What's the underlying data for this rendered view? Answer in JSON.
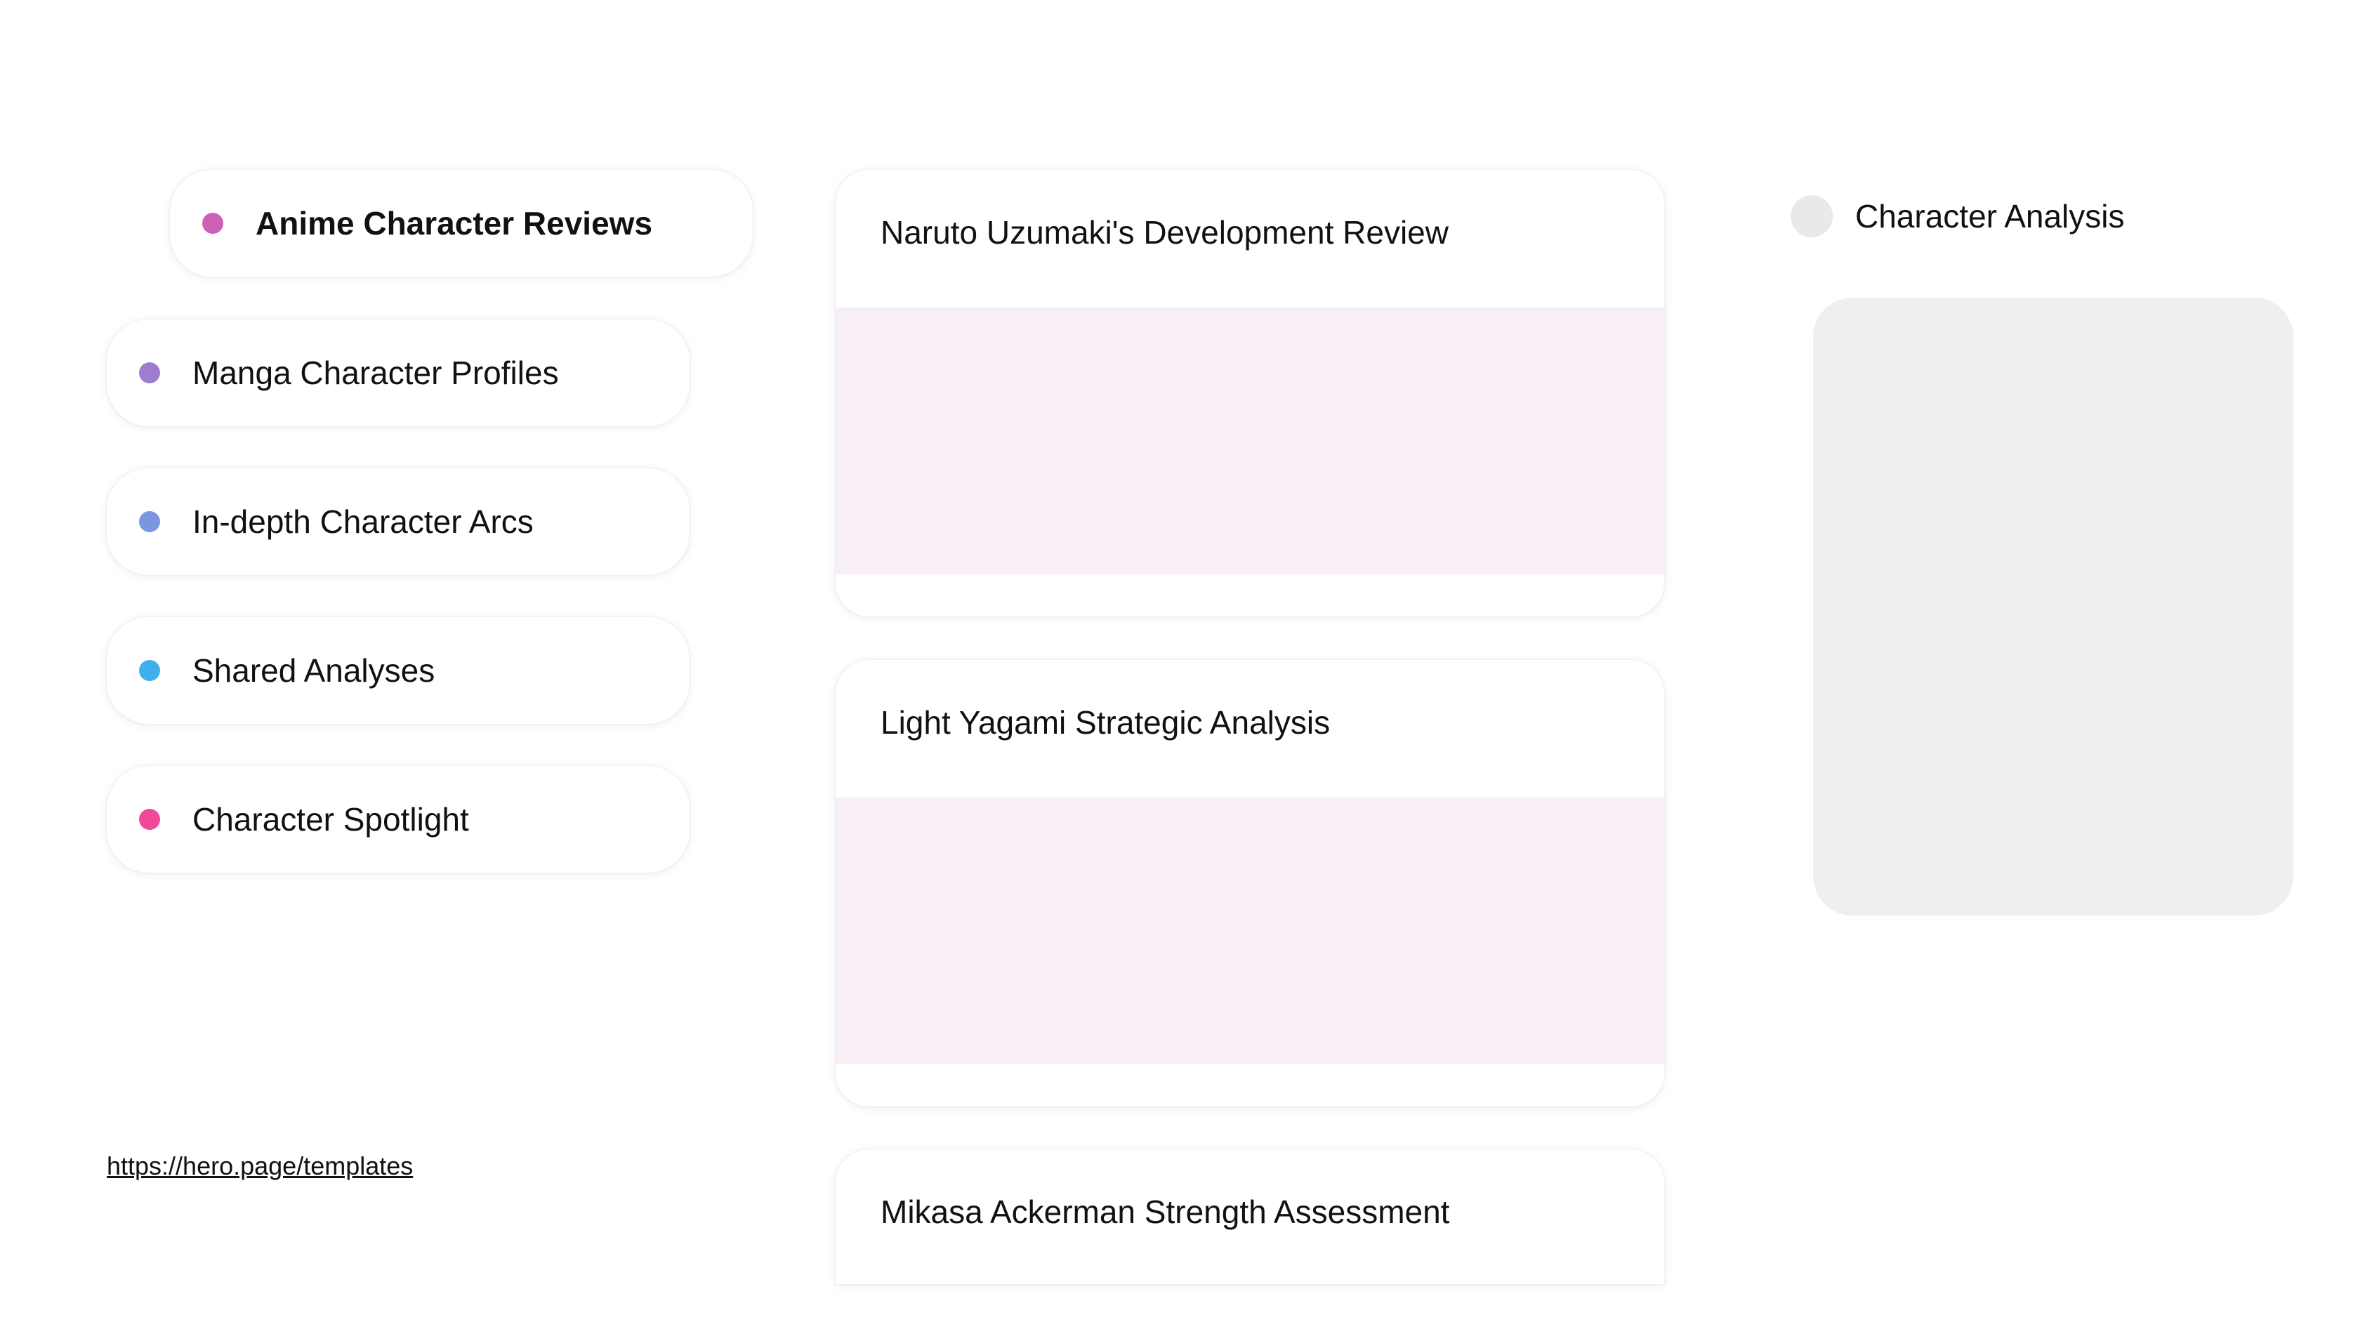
{
  "sidebar": {
    "items": [
      {
        "label": "Anime Character Reviews",
        "dot_color": "#cc5fb8",
        "active": true
      },
      {
        "label": "Manga Character Profiles",
        "dot_color": "#a07ccf",
        "active": false
      },
      {
        "label": "In-depth Character Arcs",
        "dot_color": "#7b96e0",
        "active": false
      },
      {
        "label": "Shared Analyses",
        "dot_color": "#3fb0ee",
        "active": false
      },
      {
        "label": "Character Spotlight",
        "dot_color": "#f0499a",
        "active": false
      }
    ]
  },
  "footer": {
    "url": "https://hero.page/templates"
  },
  "main": {
    "cards": [
      {
        "title": "Naruto Uzumaki's Development Review",
        "media_color": "#f8eef6"
      },
      {
        "title": "Light Yagami Strategic Analysis",
        "media_color": "#f8eef6"
      },
      {
        "title": "Mikasa Ackerman Strength Assessment",
        "media_color": "#f8eef6"
      }
    ]
  },
  "detail": {
    "title": "Character Analysis",
    "avatar_color": "#e9e9e9",
    "placeholder_color": "#efefef"
  },
  "theme": {
    "background": "#ffffff",
    "text": "#111111"
  }
}
